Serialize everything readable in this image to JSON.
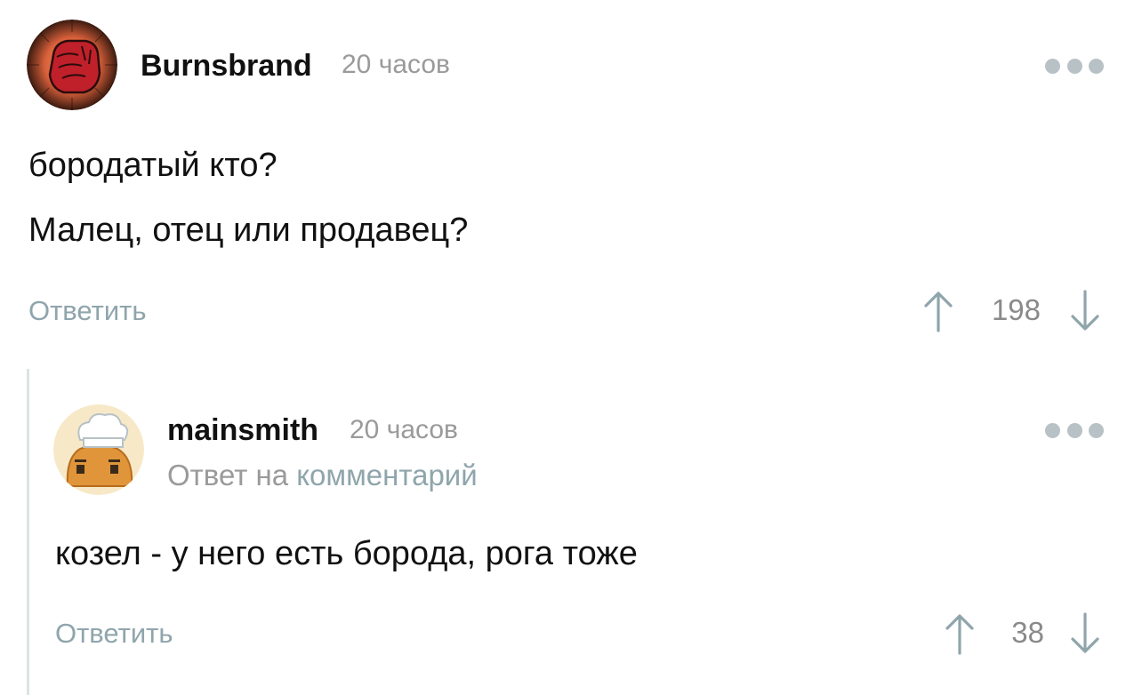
{
  "comments": [
    {
      "author": "Burnsbrand",
      "time": "20 часов",
      "text_lines": [
        "бородатый кто?",
        "Малец, отец или продавец?"
      ],
      "reply_label": "Ответить",
      "rating": "198",
      "avatar": "red-fist-avatar"
    },
    {
      "author": "mainsmith",
      "time": "20 часов",
      "reply_to_prefix": "Ответ на",
      "reply_to_link": "комментарий",
      "text_lines": [
        "козел - у него есть борода, рога тоже"
      ],
      "reply_label": "Ответить",
      "rating": "38",
      "avatar": "chef-bread-avatar"
    }
  ],
  "icons": {
    "upvote": "arrow-up-icon",
    "downvote": "arrow-down-icon",
    "more": "more-dots-icon"
  },
  "colors": {
    "accent": "#8fa5ac",
    "muted": "#9a9a9a",
    "dots": "#b8c2c6",
    "thread_line": "#dde3e5"
  }
}
